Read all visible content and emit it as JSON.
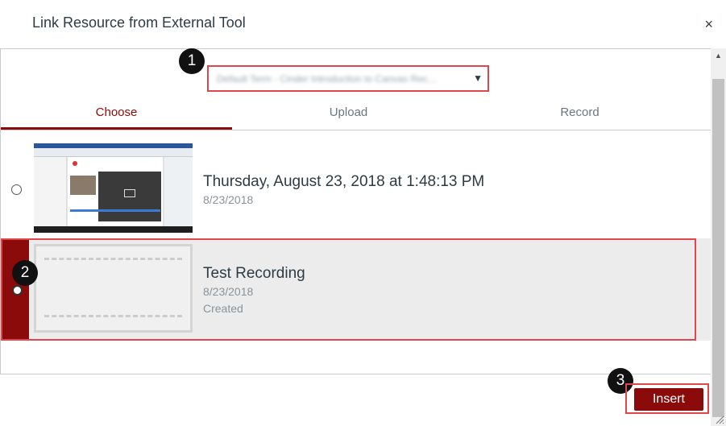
{
  "header": {
    "title": "Link Resource from External Tool",
    "close_glyph": "×"
  },
  "source_select": {
    "value": "Default Term - Cinder Introduction to Canvas Rec...",
    "arrow": "▼"
  },
  "badges": {
    "one": "1",
    "two": "2",
    "three": "3"
  },
  "tabs": [
    {
      "label": "Choose",
      "active": true
    },
    {
      "label": "Upload",
      "active": false
    },
    {
      "label": "Record",
      "active": false
    }
  ],
  "items": [
    {
      "title": "Thursday, August 23, 2018 at 1:48:13 PM",
      "date": "8/23/2018",
      "status": ""
    },
    {
      "title": "Test Recording",
      "date": "8/23/2018",
      "status": "Created"
    }
  ],
  "footer": {
    "insert_label": "Insert"
  },
  "colors": {
    "accent": "#8b0a0a",
    "highlight": "#e0474c"
  }
}
